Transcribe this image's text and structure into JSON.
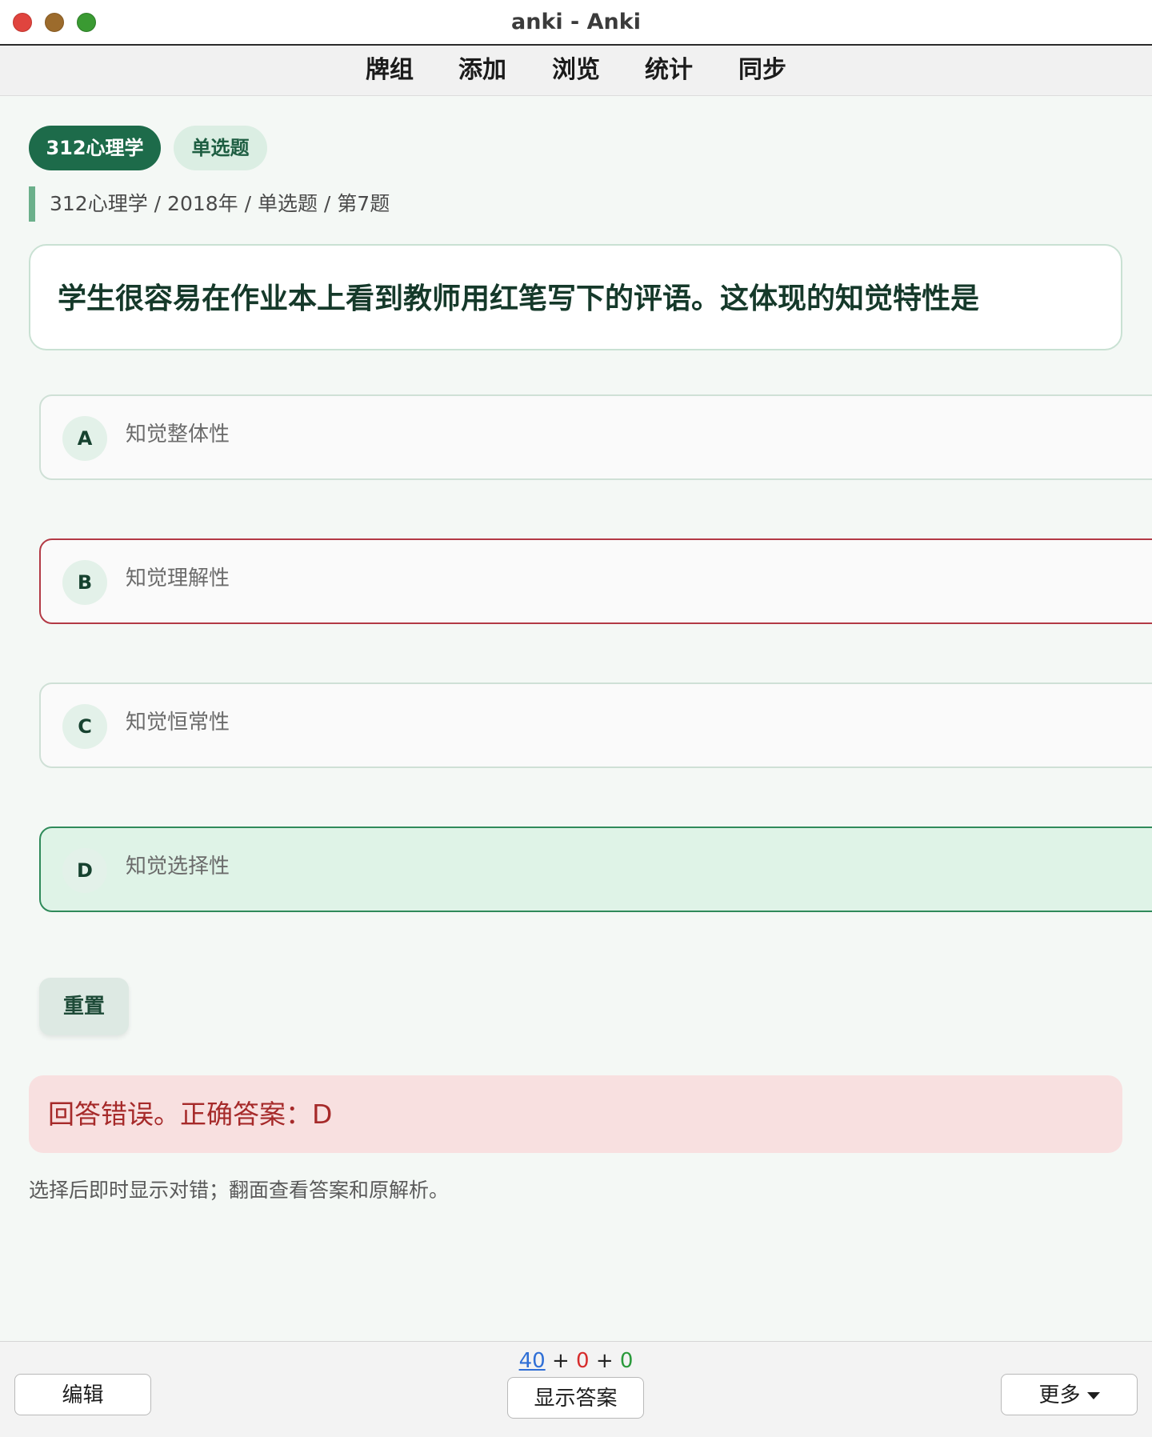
{
  "window": {
    "title": "anki - Anki"
  },
  "toolbar": {
    "items": [
      "牌组",
      "添加",
      "浏览",
      "统计",
      "同步"
    ]
  },
  "card": {
    "tags": {
      "deck": "312心理学",
      "type": "单选题"
    },
    "breadcrumb": "312心理学 / 2018年 / 单选题 / 第7题",
    "question": "学生很容易在作业本上看到教师用红笔写下的评语。这体现的知觉特性是",
    "options": [
      {
        "letter": "A",
        "text": "知觉整体性",
        "state": "normal"
      },
      {
        "letter": "B",
        "text": "知觉理解性",
        "state": "wrong"
      },
      {
        "letter": "C",
        "text": "知觉恒常性",
        "state": "normal"
      },
      {
        "letter": "D",
        "text": "知觉选择性",
        "state": "correct"
      }
    ],
    "reset_label": "重置",
    "feedback": "回答错误。正确答案：D",
    "hint": "选择后即时显示对错；翻面查看答案和原解析。"
  },
  "bottom": {
    "edit_label": "编辑",
    "show_answer_label": "显示答案",
    "more_label": "更多",
    "counts": {
      "new": "40",
      "plus1": "+",
      "learn": "0",
      "plus2": "+",
      "review": "0"
    }
  },
  "colors": {
    "accent": "#1d6b4a",
    "wrong_border": "#b33a45",
    "correct_border": "#2f8a5a",
    "correct_bg": "#dff3e7",
    "feedback_bg": "#f8e0e0",
    "feedback_text": "#a62a2a",
    "count_new": "#2f6fd6",
    "count_learn": "#d62c2c",
    "count_review": "#2a9a3b"
  }
}
